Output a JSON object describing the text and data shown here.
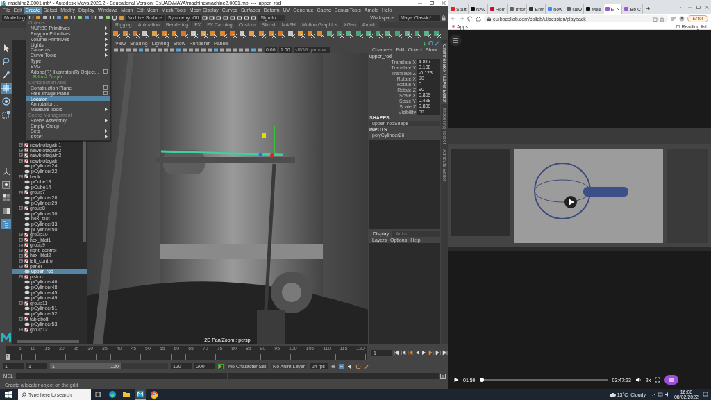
{
  "maya": {
    "title": "machine2.0001.mb* - Autodesk Maya 2020.2 - Educational Version: E:\\UAD\\MAYA\\machine\\machine2.0001.mb  ---  upper_rod",
    "menubar": [
      {
        "label": "File",
        "open": false
      },
      {
        "label": "Edit",
        "open": false
      },
      {
        "label": "Create",
        "open": true
      },
      {
        "label": "Select",
        "open": false
      },
      {
        "label": "Modify",
        "open": false
      },
      {
        "label": "Display",
        "open": false
      },
      {
        "label": "Windows",
        "open": false
      },
      {
        "label": "Mesh",
        "open": false
      },
      {
        "label": "Edit Mesh",
        "open": false
      },
      {
        "label": "Mesh Tools",
        "open": false
      },
      {
        "label": "Mesh Display",
        "open": false
      },
      {
        "label": "Curves",
        "open": false
      },
      {
        "label": "Surfaces",
        "open": false
      },
      {
        "label": "Deform",
        "open": false
      },
      {
        "label": "UV",
        "open": false
      },
      {
        "label": "Generate",
        "open": false
      },
      {
        "label": "Cache",
        "open": false
      },
      {
        "label": "Bonus Tools",
        "open": false
      },
      {
        "label": "Arnold",
        "open": false
      },
      {
        "label": "Help",
        "open": false
      }
    ],
    "status_line": {
      "mode": "Modelling",
      "live_surface": "No Live Surface",
      "symmetry": "Symmetry: Off",
      "sign_in": "Sign In",
      "workspace_label": "Workspace :",
      "workspace": "Maya Classic*"
    },
    "shelf_tabs": [
      {
        "label": "Rigging",
        "selected": false
      },
      {
        "label": "Animation",
        "selected": false
      },
      {
        "label": "Rendering",
        "selected": false
      },
      {
        "label": "FX",
        "selected": false
      },
      {
        "label": "FX Caching",
        "selected": false
      },
      {
        "label": "Custom",
        "selected": false
      },
      {
        "label": "Bifrost",
        "selected": false
      },
      {
        "label": "MASH",
        "selected": false
      },
      {
        "label": "Motion Graphics",
        "selected": false
      },
      {
        "label": "XGen",
        "selected": false
      },
      {
        "label": "Arnold",
        "selected": false
      }
    ],
    "create_menu": [
      {
        "kind": "header",
        "label": "Objects"
      },
      {
        "kind": "item",
        "label": "NURBS Primitives",
        "submenu": true,
        "option_box": false,
        "selected": false
      },
      {
        "kind": "item",
        "label": "Polygon Primitives",
        "submenu": true,
        "option_box": false,
        "selected": false
      },
      {
        "kind": "item",
        "label": "Volume Primitives",
        "submenu": true,
        "option_box": false,
        "selected": false
      },
      {
        "kind": "item",
        "label": "Lights",
        "submenu": true,
        "option_box": false,
        "selected": false
      },
      {
        "kind": "item",
        "label": "Cameras",
        "submenu": true,
        "option_box": false,
        "selected": false
      },
      {
        "kind": "item",
        "label": "Curve Tools",
        "submenu": true,
        "option_box": false,
        "selected": false
      },
      {
        "kind": "item",
        "label": "Type",
        "submenu": false,
        "option_box": false,
        "selected": false
      },
      {
        "kind": "item",
        "label": "SVG",
        "submenu": false,
        "option_box": false,
        "selected": false
      },
      {
        "kind": "item",
        "label": "Adobe(R) Illustrator(R) Object...",
        "submenu": false,
        "option_box": true,
        "selected": false
      },
      {
        "kind": "plugin",
        "label": "Bifrost Graph"
      },
      {
        "kind": "header",
        "label": "Construction Aids"
      },
      {
        "kind": "item",
        "label": "Construction Plane",
        "submenu": false,
        "option_box": true,
        "selected": false
      },
      {
        "kind": "item",
        "label": "Free Image Plane",
        "submenu": false,
        "option_box": true,
        "selected": false
      },
      {
        "kind": "item",
        "label": "Locator",
        "submenu": false,
        "option_box": false,
        "selected": true
      },
      {
        "kind": "item",
        "label": "Annotation...",
        "submenu": false,
        "option_box": false,
        "selected": false
      },
      {
        "kind": "item",
        "label": "Measure Tools",
        "submenu": true,
        "option_box": false,
        "selected": false
      },
      {
        "kind": "header",
        "label": "Scene Management"
      },
      {
        "kind": "item",
        "label": "Scene Assembly",
        "submenu": true,
        "option_box": false,
        "selected": false
      },
      {
        "kind": "item",
        "label": "Empty Group",
        "submenu": false,
        "option_box": false,
        "selected": false
      },
      {
        "kind": "item",
        "label": "Sets",
        "submenu": true,
        "option_box": false,
        "selected": false
      },
      {
        "kind": "item",
        "label": "Asset",
        "submenu": true,
        "option_box": false,
        "selected": false
      }
    ],
    "outliner": [
      {
        "label": "newblotagain1",
        "kind": "group",
        "selected": false
      },
      {
        "label": "newblotagain2",
        "kind": "group",
        "selected": false
      },
      {
        "label": "newblotagain3",
        "kind": "group",
        "selected": false
      },
      {
        "label": "newblotagain",
        "kind": "group",
        "selected": false
      },
      {
        "label": "pCylinder24",
        "kind": "mesh",
        "selected": false
      },
      {
        "label": "pCylinder22",
        "kind": "mesh",
        "selected": false
      },
      {
        "label": "back",
        "kind": "group",
        "selected": false
      },
      {
        "label": "pCube13",
        "kind": "mesh",
        "selected": false
      },
      {
        "label": "pCube14",
        "kind": "mesh",
        "selected": false
      },
      {
        "label": "group7",
        "kind": "group",
        "selected": false
      },
      {
        "label": "pCylinder28",
        "kind": "mesh",
        "selected": false
      },
      {
        "label": "pCylinder29",
        "kind": "mesh",
        "selected": false
      },
      {
        "label": "group8",
        "kind": "group",
        "selected": false
      },
      {
        "label": "pCylinder30",
        "kind": "mesh",
        "selected": false
      },
      {
        "label": "hex_blot",
        "kind": "mesh",
        "selected": false
      },
      {
        "label": "pCylinder33",
        "kind": "mesh",
        "selected": false
      },
      {
        "label": "pCylinder50",
        "kind": "mesh",
        "selected": false
      },
      {
        "label": "group10",
        "kind": "group",
        "selected": false
      },
      {
        "label": "hex_blot1",
        "kind": "group",
        "selected": false
      },
      {
        "label": "group9",
        "kind": "group",
        "selected": false
      },
      {
        "label": "right_control",
        "kind": "group",
        "selected": false
      },
      {
        "label": "hex_blot2",
        "kind": "group",
        "selected": false
      },
      {
        "label": "left_control",
        "kind": "group",
        "selected": false
      },
      {
        "label": "panel",
        "kind": "group",
        "selected": false
      },
      {
        "label": "upper_rod",
        "kind": "mesh",
        "selected": true
      },
      {
        "label": "piston",
        "kind": "group",
        "selected": false
      },
      {
        "label": "pCylinder46",
        "kind": "mesh",
        "selected": false
      },
      {
        "label": "pCylinder48",
        "kind": "mesh",
        "selected": false
      },
      {
        "label": "pCylinder45",
        "kind": "mesh",
        "selected": false
      },
      {
        "label": "pCylinder49",
        "kind": "mesh",
        "selected": false
      },
      {
        "label": "group11",
        "kind": "group",
        "selected": false
      },
      {
        "label": "pCylinder51",
        "kind": "mesh",
        "selected": false
      },
      {
        "label": "pCylinder52",
        "kind": "mesh",
        "selected": false
      },
      {
        "label": "tablebolt",
        "kind": "group",
        "selected": false
      },
      {
        "label": "pCylinder53",
        "kind": "mesh",
        "selected": false
      },
      {
        "label": "group12",
        "kind": "group",
        "selected": false
      }
    ],
    "viewport": {
      "menus": [
        "View",
        "Shading",
        "Lighting",
        "Show",
        "Renderer",
        "Panels"
      ],
      "exposure": "0.00",
      "gamma": "1.00",
      "color_space": "sRGB gamma",
      "camera_label": "2D Pan/Zoom : persp"
    },
    "channel_box": {
      "menus": [
        "Channels",
        "Edit",
        "Object",
        "Show"
      ],
      "object": "upper_rod",
      "attributes": [
        {
          "label": "Translate X",
          "value": "4.817"
        },
        {
          "label": "Translate Y",
          "value": "0.108"
        },
        {
          "label": "Translate Z",
          "value": "-0.123"
        },
        {
          "label": "Rotate X",
          "value": "90"
        },
        {
          "label": "Rotate Y",
          "value": "0"
        },
        {
          "label": "Rotate Z",
          "value": "90"
        },
        {
          "label": "Scale X",
          "value": "0.809"
        },
        {
          "label": "Scale Y",
          "value": "0.498"
        },
        {
          "label": "Scale Z",
          "value": "0.809"
        },
        {
          "label": "Visibility",
          "value": "on"
        }
      ],
      "shapes_header": "SHAPES",
      "shape": "upper_rodShape",
      "inputs_header": "INPUTS",
      "input": "polyCylinder26",
      "layer_tabs": [
        {
          "label": "Display",
          "selected": true
        },
        {
          "label": "Anim",
          "selected": false
        }
      ],
      "layer_menus": [
        "Layers",
        "Options",
        "Help"
      ],
      "side_tabs": [
        {
          "label": "Channel Box / Layer Editor",
          "selected": true
        },
        {
          "label": "Modelling Toolkit",
          "selected": false
        },
        {
          "label": "Attribute Editor",
          "selected": false
        }
      ]
    },
    "time_slider": {
      "ticks": [
        "5",
        "10",
        "15",
        "20",
        "25",
        "30",
        "35",
        "40",
        "45",
        "50",
        "55",
        "60",
        "65",
        "70",
        "75",
        "80",
        "85",
        "90",
        "95",
        "100",
        "105",
        "110",
        "115",
        "120"
      ],
      "current_frame": "1",
      "marker_frame": "1"
    },
    "range": {
      "start": "1",
      "playback_start": "1",
      "slider_start": "1",
      "slider_end": "120",
      "level": 0.6,
      "playback_end": "120",
      "end": "200",
      "character_set": "No Character Set",
      "anim_layer": "No Anim Layer",
      "fps": "24 fps"
    },
    "command_line": {
      "label": "MEL"
    },
    "help_line": "Create a locator object on the grid"
  },
  "browser": {
    "tabs": [
      {
        "label": "Start",
        "color": "#e62117",
        "selected": false
      },
      {
        "label": "NAV",
        "color": "#111111",
        "selected": false
      },
      {
        "label": "Hom",
        "color": "#c8102e",
        "selected": false
      },
      {
        "label": "Infor",
        "color": "#5f6368",
        "selected": false
      },
      {
        "label": "Entr",
        "color": "#333333",
        "selected": false
      },
      {
        "label": "how",
        "color": "#4285f4",
        "selected": false
      },
      {
        "label": "New",
        "color": "#5f6368",
        "selected": false
      },
      {
        "label": "Mee",
        "color": "#111111",
        "selected": false
      },
      {
        "label": "E",
        "color": "#9b59d0",
        "selected": true
      },
      {
        "label": "Bb C",
        "color": "#9b59d0",
        "selected": false
      }
    ],
    "url": "eu.bbcollab.com/collab/ui/session/playback",
    "error_button": "Error",
    "bookmarks": [
      "Apps"
    ],
    "reading_list": "Reading list",
    "player": {
      "elapsed": "01:59",
      "level": 0.01,
      "duration": "03:47:23",
      "speed": "2x"
    }
  },
  "taskbar": {
    "search_placeholder": "Type here to search",
    "weather": "13°C  Cloudy",
    "time": "16:08",
    "date": "08/02/2022"
  }
}
